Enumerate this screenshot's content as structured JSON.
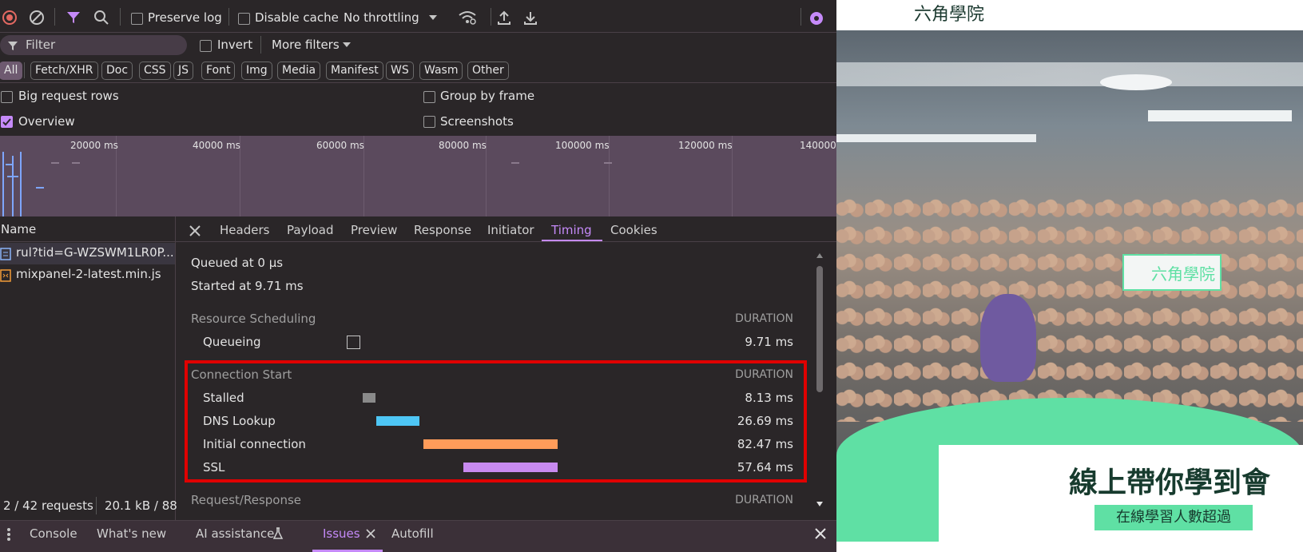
{
  "toolbar": {
    "preserve_log": "Preserve log",
    "disable_cache": "Disable cache",
    "throttling": "No throttling",
    "throttling_options": [
      "No throttling"
    ]
  },
  "filter_bar": {
    "filter_placeholder": "Filter",
    "invert": "Invert",
    "more_filters": "More filters"
  },
  "type_filters": [
    "All",
    "Fetch/XHR",
    "Doc",
    "CSS",
    "JS",
    "Font",
    "Img",
    "Media",
    "Manifest",
    "WS",
    "Wasm",
    "Other"
  ],
  "options": {
    "big_request_rows": "Big request rows",
    "group_by_frame": "Group by frame",
    "overview": "Overview",
    "screenshots": "Screenshots",
    "overview_checked": true
  },
  "overview_ticks": [
    "20000 ms",
    "40000 ms",
    "60000 ms",
    "80000 ms",
    "100000 ms",
    "120000 ms",
    "140000"
  ],
  "requests": {
    "header": "Name",
    "items": [
      "rul?tid=G-WZSWM1LR0P...",
      "mixpanel-2-latest.min.js"
    ]
  },
  "detail_tabs": [
    "Headers",
    "Payload",
    "Preview",
    "Response",
    "Initiator",
    "Timing",
    "Cookies"
  ],
  "active_detail_tab": "Timing",
  "timing": {
    "queued_at": "Queued at 0 µs",
    "started_at": "Started at 9.71 ms",
    "duration_header": "DURATION",
    "resource_scheduling": {
      "title": "Resource Scheduling",
      "rows": [
        {
          "label": "Queueing",
          "duration": "9.71 ms"
        }
      ]
    },
    "connection_start": {
      "title": "Connection Start",
      "rows": [
        {
          "label": "Stalled",
          "duration": "8.13 ms",
          "color": "#8a8a8a"
        },
        {
          "label": "DNS Lookup",
          "duration": "26.69 ms",
          "color": "#4ec6f5"
        },
        {
          "label": "Initial connection",
          "duration": "82.47 ms",
          "color": "#ff9c5a"
        },
        {
          "label": "SSL",
          "duration": "57.64 ms",
          "color": "#c88af0"
        }
      ]
    },
    "request_response": {
      "title": "Request/Response"
    }
  },
  "status_bar": {
    "requests": "2 / 42 requests",
    "transferred": "20.1 kB / 88"
  },
  "bottom_tabs": [
    "Console",
    "What's new",
    "AI assistance",
    "Issues",
    "Autofill"
  ],
  "webpage": {
    "logo_text": "六角學院",
    "heading": "線上帶你學到會",
    "subheading": "在線學習人數超過",
    "sign_text": "六角學院"
  },
  "colors": {
    "accent": "#c58af9",
    "highlight_box": "#e00000",
    "brand_green": "#5fe0a4"
  }
}
